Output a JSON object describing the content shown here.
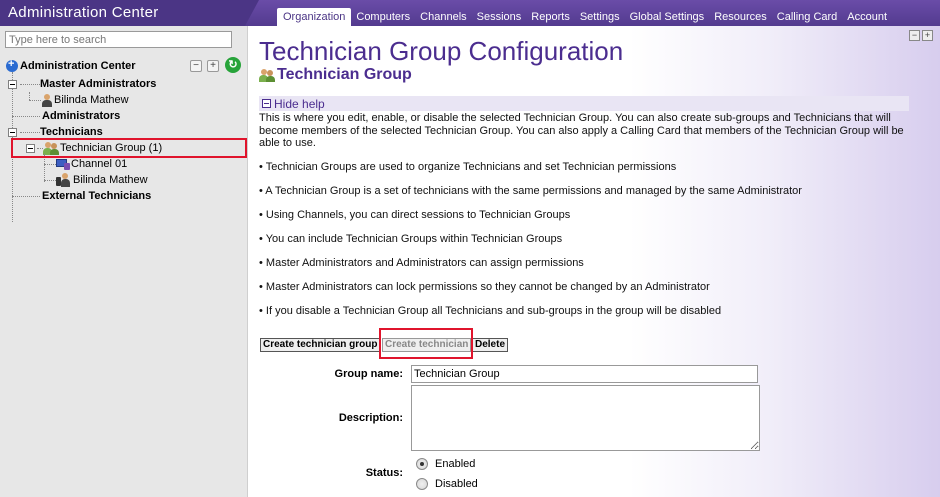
{
  "app": {
    "title": "Administration Center"
  },
  "nav": {
    "tabs": [
      {
        "label": "Organization",
        "active": true
      },
      {
        "label": "Computers"
      },
      {
        "label": "Channels"
      },
      {
        "label": "Sessions"
      },
      {
        "label": "Reports"
      },
      {
        "label": "Settings"
      },
      {
        "label": "Global Settings"
      },
      {
        "label": "Resources"
      },
      {
        "label": "Calling Card"
      },
      {
        "label": "Account"
      }
    ]
  },
  "sidebar": {
    "search_placeholder": "Type here to search",
    "tree": {
      "root": "Administration Center",
      "master_admins": "Master Administrators",
      "master_admin_user": "Bilinda Mathew",
      "administrators": "Administrators",
      "technicians": "Technicians",
      "technician_group": "Technician Group (1)",
      "channel": "Channel 01",
      "technician_user": "Bilinda Mathew",
      "external_technicians": "External Technicians"
    }
  },
  "main": {
    "title": "Technician Group Configuration",
    "subtitle": "Technician Group",
    "help_toggle": "Hide help",
    "help_intro": "This is where you edit, enable, or disable the selected Technician Group. You can also create sub-groups and Technicians that will become members of the selected Technician Group. You can also apply a Calling Card that members of the Technician Group will be able to use.",
    "bullets": [
      "• Technician Groups are used to organize Technicians and set Technician permissions",
      "• A Technician Group is a set of technicians with the same permissions and managed by the same Administrator",
      "• Using Channels, you can direct sessions to Technician Groups",
      "• You can include Technician Groups within Technician Groups",
      "• Master Administrators and Administrators can assign permissions",
      "• Master Administrators can lock permissions so they cannot be changed by an Administrator",
      "• If you disable a Technician Group all Technicians and sub-groups in the group will be disabled"
    ],
    "actions": {
      "create_group": "Create technician group",
      "create_technician": "Create technician",
      "delete": "Delete"
    },
    "form": {
      "group_name_label": "Group name:",
      "group_name_value": "Technician Group",
      "description_label": "Description:",
      "description_value": "",
      "status_label": "Status:",
      "status_options": [
        "Enabled",
        "Disabled"
      ],
      "status_selected": "Enabled"
    }
  }
}
